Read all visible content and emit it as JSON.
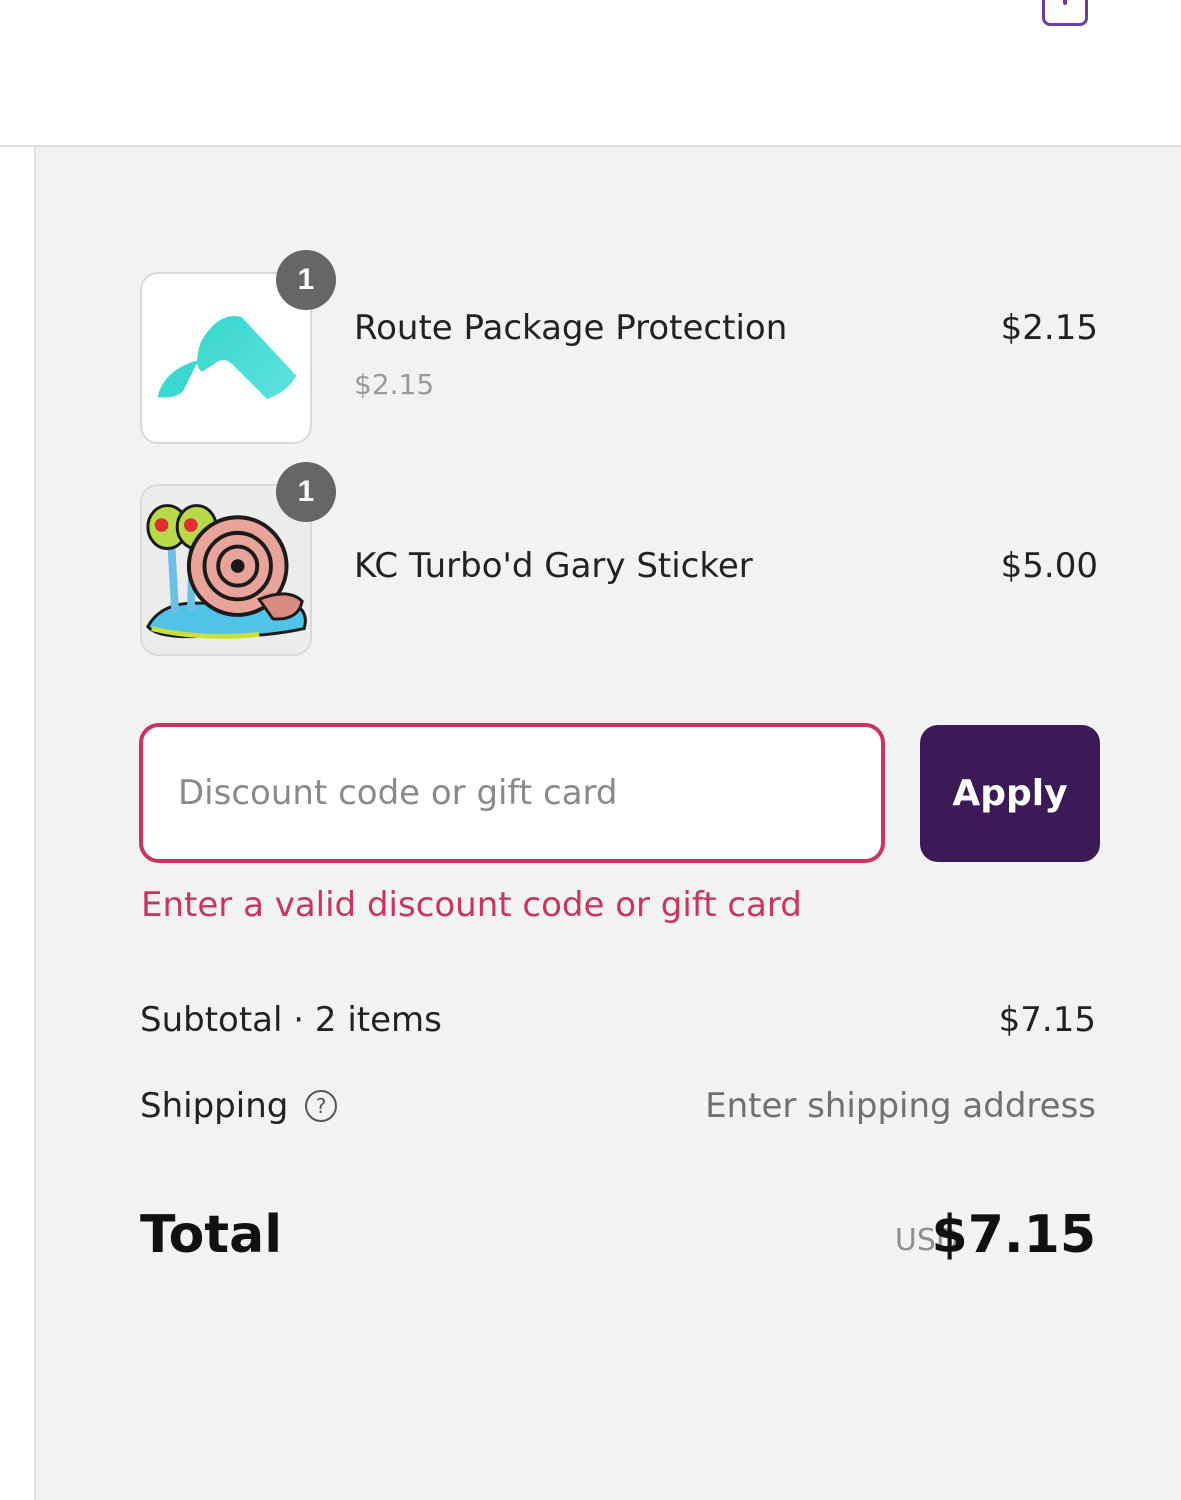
{
  "header": {
    "cart_icon": "bag-icon"
  },
  "line_items": [
    {
      "name": "Route Package Protection",
      "unit_price": "$2.15",
      "price": "$2.15",
      "quantity": "1",
      "image": "route-logo-image"
    },
    {
      "name": "KC Turbo'd Gary Sticker",
      "price": "$5.00",
      "quantity": "1",
      "image": "snail-sticker-image"
    }
  ],
  "discount": {
    "placeholder": "Discount code or gift card",
    "value": "",
    "apply_label": "Apply",
    "error": "Enter a valid discount code or gift card"
  },
  "totals": {
    "subtotal_label": "Subtotal · 2 items",
    "subtotal_value": "$7.15",
    "shipping_label": "Shipping",
    "shipping_value": "Enter shipping address",
    "help_icon": "question-circle-icon",
    "total_label": "Total",
    "currency": "USD",
    "total_value": "$7.15"
  },
  "colors": {
    "brand": "#3b1a57",
    "error": "#c7365f",
    "panel_background": "#f2f2f2"
  }
}
